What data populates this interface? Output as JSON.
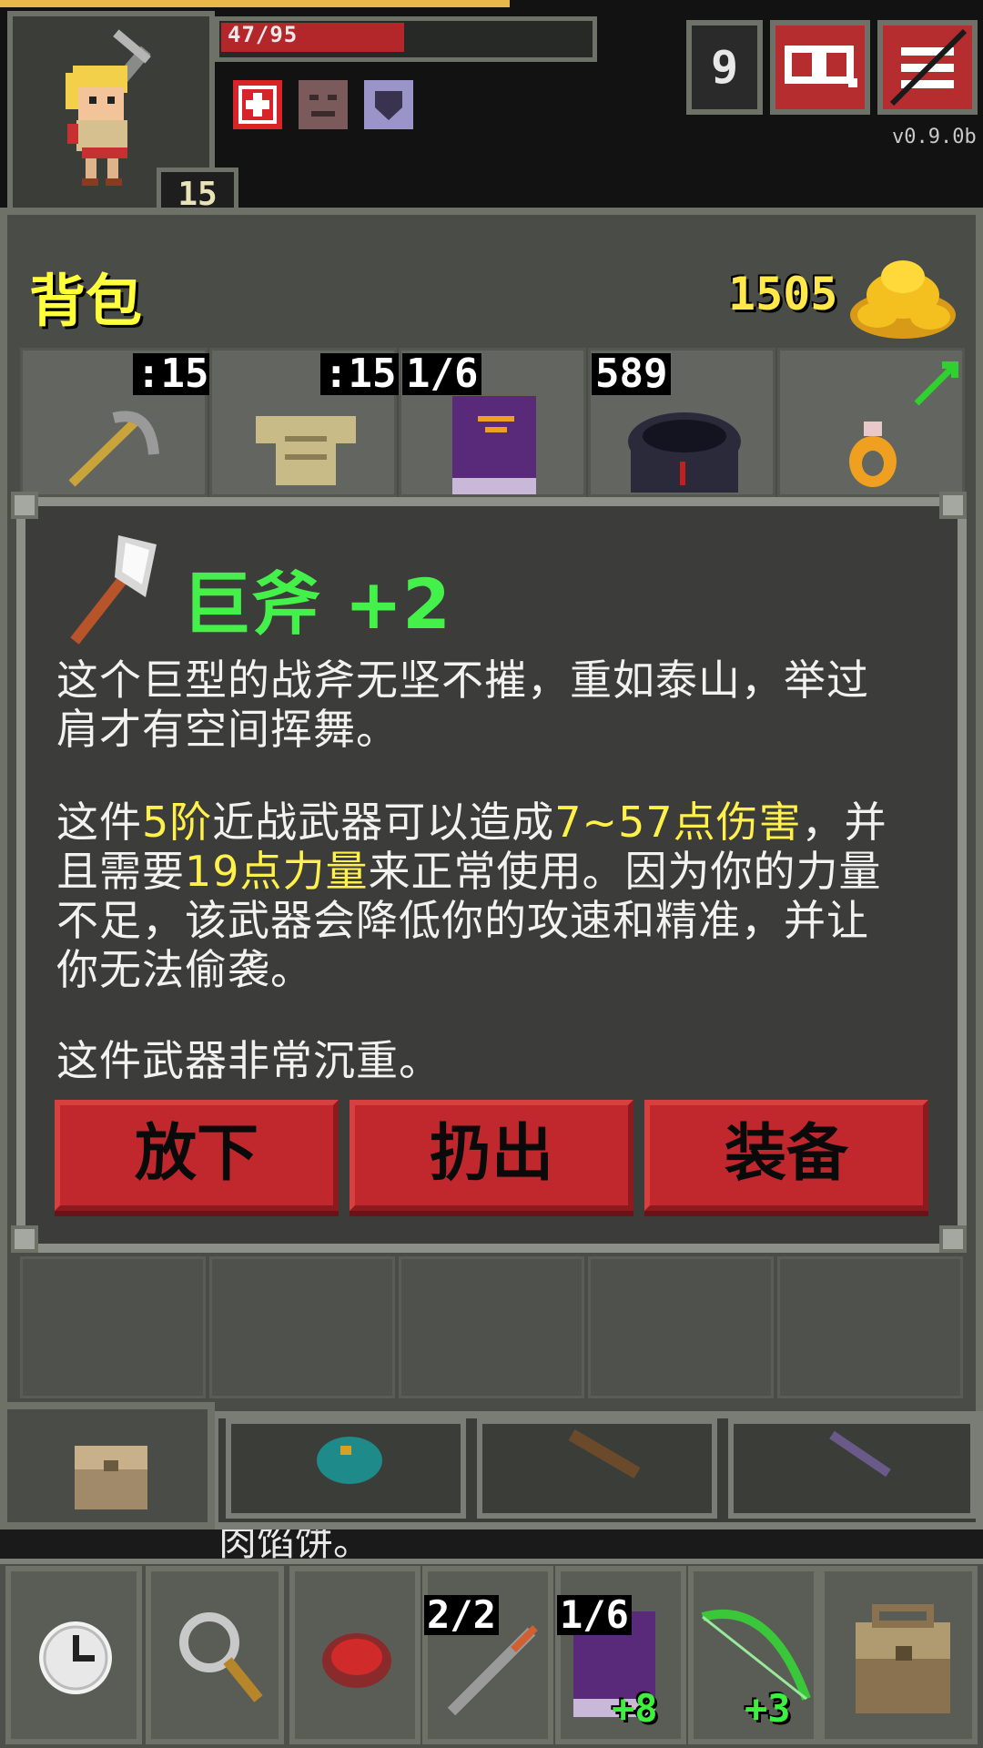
{
  "hud": {
    "hp_text": "47/95",
    "hp_fraction": 0.49,
    "hero_level": "15",
    "depth": "9",
    "version": "v0.9.0b",
    "buffs": [
      "heal-buff-icon",
      "curse-face-icon",
      "shield-buff-icon"
    ]
  },
  "backpack": {
    "title": "背包",
    "gold": "1505",
    "equipped_slots": [
      {
        "name": "pickaxe",
        "badge": ":15"
      },
      {
        "name": "armor",
        "badge": ":15"
      },
      {
        "name": "spellbook",
        "badge": "1/6"
      },
      {
        "name": "cloak",
        "badge": "589"
      },
      {
        "name": "ring",
        "badge": ""
      }
    ]
  },
  "item_window": {
    "title": "巨斧 +2",
    "desc_line1": "这个巨型的战斧无坚不摧，重如泰山，举过",
    "desc_line2": "肩才有空间挥舞。",
    "p2_a": "这件",
    "p2_tier": "5阶",
    "p2_b": "近战武器可以造成",
    "p2_dmg": "7~57点伤害",
    "p2_c": "，并",
    "p2_d": "且需要",
    "p2_str": "19点力量",
    "p2_e": "来正常使用。因为你的力量",
    "p2_line3": "不足，该武器会降低你的攻速和精准，并让",
    "p2_line4": "你无法偷袭。",
    "p3": "这件武器非常沉重。",
    "buttons": {
      "drop": "放下",
      "throw": "扔出",
      "equip": "装备"
    }
  },
  "background_text": "肉馅饼。",
  "quickbar": [
    {
      "name": "wait",
      "badge": ""
    },
    {
      "name": "search",
      "badge": ""
    },
    {
      "name": "meat",
      "badge": ""
    },
    {
      "name": "dart",
      "badge": "2/2"
    },
    {
      "name": "spellbook",
      "badge": "1/6",
      "plus": "+8"
    },
    {
      "name": "bow",
      "badge": "",
      "plus": "+3"
    },
    {
      "name": "backpack",
      "badge": ""
    }
  ],
  "colors": {
    "title_green": "#44f04a",
    "highlight_yellow": "#fff04a",
    "button_red": "#c0282d",
    "gold": "#ffe84a"
  }
}
